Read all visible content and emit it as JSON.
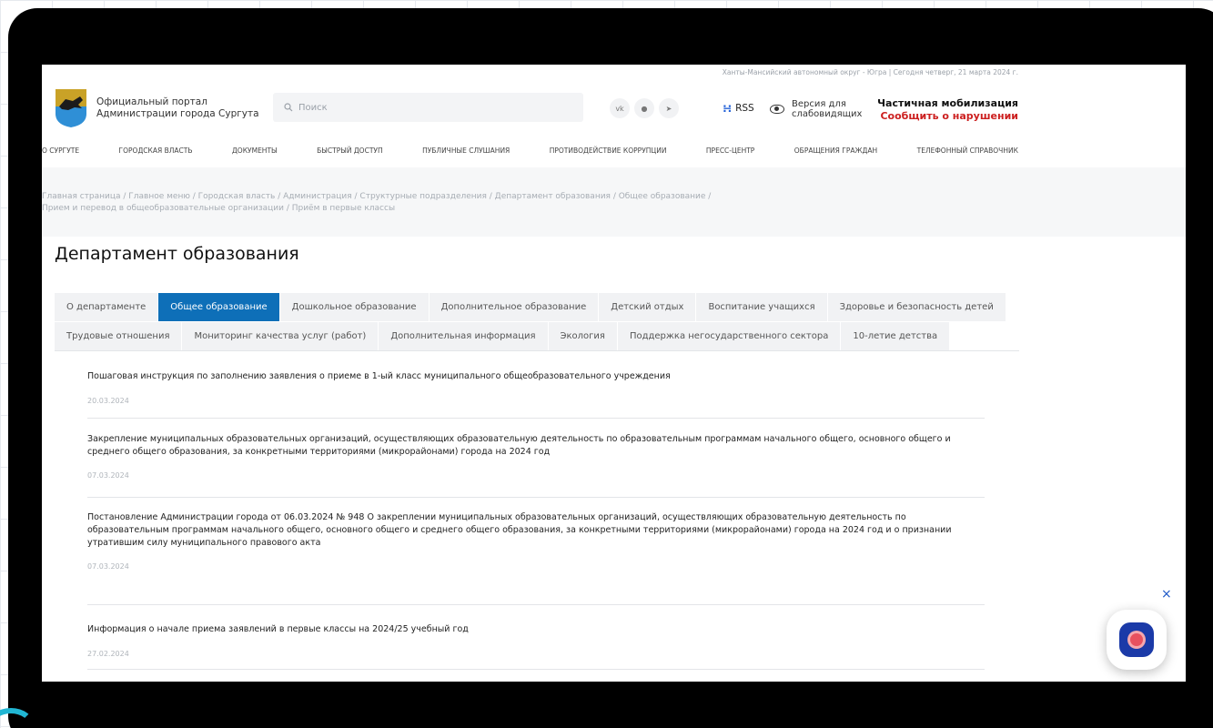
{
  "header": {
    "region_line": "Ханты-Мансийский автономный округ - Югра | Сегодня четверг, 21 марта 2024 г.",
    "portal_line1": "Официальный портал",
    "portal_line2": "Администрации города Сургута",
    "search_placeholder": "Поиск",
    "social": [
      "vk-icon",
      "ok-icon",
      "telegram-icon"
    ],
    "rss_label": "RSS",
    "accessibility_line1": "Версия для",
    "accessibility_line2": "слабовидящих",
    "mobilization_title": "Частичная мобилизация",
    "mobilization_link": "Сообщить о нарушении",
    "colors": {
      "accent": "#0e6fb8",
      "alert": "#cc1f1f"
    }
  },
  "nav": {
    "items": [
      "О СУРГУТЕ",
      "ГОРОДСКАЯ ВЛАСТЬ",
      "ДОКУМЕНТЫ",
      "БЫСТРЫЙ ДОСТУП",
      "ПУБЛИЧНЫЕ СЛУШАНИЯ",
      "ПРОТИВОДЕЙСТВИЕ КОРРУПЦИИ",
      "ПРЕСС-ЦЕНТР",
      "ОБРАЩЕНИЯ ГРАЖДАН",
      "ТЕЛЕФОННЫЙ СПРАВОЧНИК"
    ]
  },
  "breadcrumb": {
    "line1": "Главная страница / Главное меню / Городская власть / Администрация / Структурные подразделения / Департамент образования / Общее образование /",
    "line2": "Прием и перевод в общеобразовательные организации / Приём в первые классы"
  },
  "page": {
    "title": "Департамент образования",
    "tabs_row1": [
      "О департаменте",
      "Общее образование",
      "Дошкольное образование",
      "Дополнительное образование",
      "Детский отдых",
      "Воспитание учащихся",
      "Здоровье и безопасность детей"
    ],
    "tabs_row2": [
      "Трудовые отношения",
      "Мониторинг качества услуг (работ)",
      "Дополнительная информация",
      "Экология",
      "Поддержка негосударственного сектора",
      "10-летие детства"
    ],
    "active_tab": "Общее образование"
  },
  "news": [
    {
      "title": "Пошаговая инструкция по заполнению заявления о приеме в 1-ый класс муниципального общеобразовательного учреждения",
      "date": "20.03.2024"
    },
    {
      "title": "Закрепление муниципальных образовательных организаций, осуществляющих образовательную деятельность по образовательным программам начального общего, основного общего и среднего общего образования, за конкретными территориями (микрорайонами) города на 2024 год",
      "date": "07.03.2024"
    },
    {
      "title": "Постановление Администрации города от 06.03.2024 № 948 О закреплении муниципальных образовательных организаций, осуществляющих образовательную деятельность по образовательным программам начального общего, основного общего и среднего общего образования, за конкретными территориями (микрорайонами) города на 2024 год и о признании утратившим силу муниципального правового акта",
      "date": "07.03.2024"
    },
    {
      "title": "Информация о начале приема заявлений в первые классы на 2024/25 учебный год",
      "date": "27.02.2024"
    }
  ],
  "widget": {
    "close_label": "×"
  }
}
